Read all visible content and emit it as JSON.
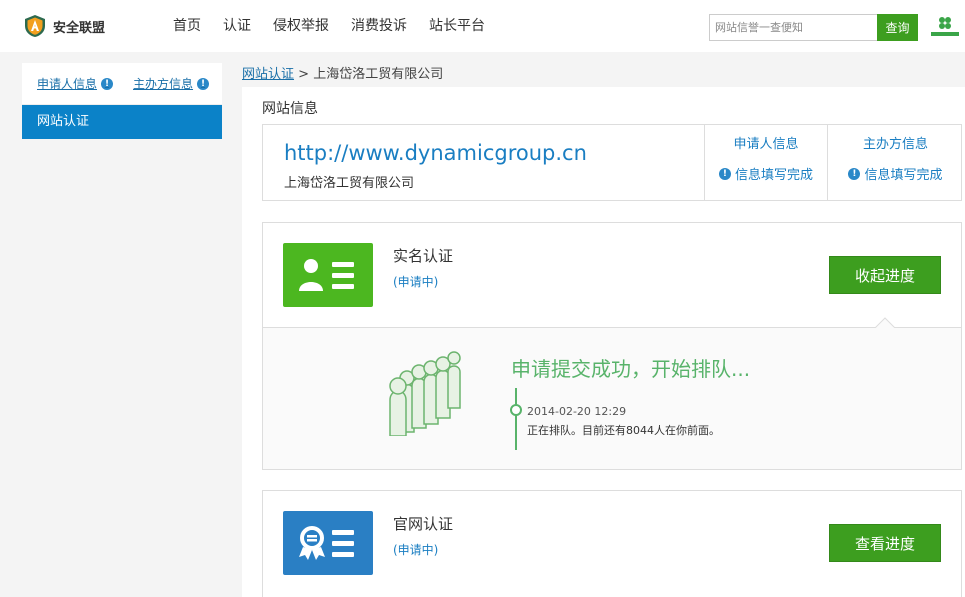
{
  "header": {
    "logo_text": "安全联盟",
    "nav": [
      "首页",
      "认证",
      "侵权举报",
      "消费投诉",
      "站长平台"
    ],
    "search_placeholder": "网站信誉一查便知",
    "search_button": "查询"
  },
  "sidebar": {
    "tabs": [
      "申请人信息",
      "主办方信息"
    ],
    "active_item": "网站认证"
  },
  "breadcrumb": {
    "link": "网站认证",
    "separator": ">",
    "current": "上海岱洛工贸有限公司"
  },
  "site_info": {
    "section_title": "网站信息",
    "url": "http://www.dynamicgroup.cn",
    "company": "上海岱洛工贸有限公司",
    "applicant_title": "申请人信息",
    "applicant_status": "信息填写完成",
    "organizer_title": "主办方信息",
    "organizer_status": "信息填写完成"
  },
  "cards": {
    "realname": {
      "title": "实名认证",
      "status": "(申请中)",
      "button": "收起进度",
      "progress_title": "申请提交成功，开始排队...",
      "progress_time": "2014-02-20 12:29",
      "progress_msg": "正在排队。目前还有8044人在你前面。"
    },
    "official": {
      "title": "官网认证",
      "status": "(申请中)",
      "button": "查看进度"
    }
  },
  "colors": {
    "green": "#3d9e1f",
    "blue": "#0b82c8",
    "link": "#1a6fa8",
    "progress_green": "#58b36a"
  }
}
